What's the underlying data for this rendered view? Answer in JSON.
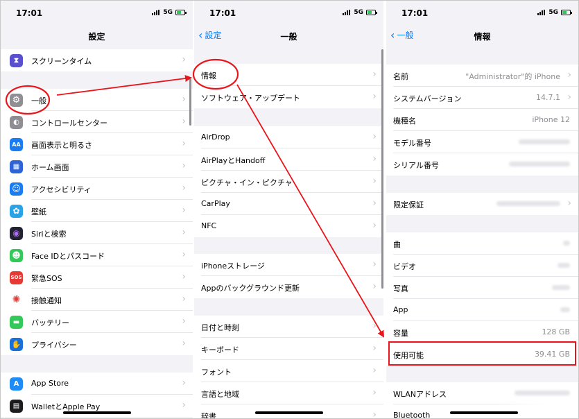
{
  "colors": {
    "accent": "#007aff",
    "annotation": "#e8151b",
    "icons": {
      "screen-time": "#5a4fcf",
      "general": "#8e8e93",
      "control-center": "#8e8e93",
      "display": "#1a7cf0",
      "home-screen": "#2c64d6",
      "accessibility": "#1a7cf0",
      "wallpaper": "#2aa3e6",
      "siri": "#222233",
      "face-id": "#34c759",
      "sos": "#e53935",
      "exposure": "#ffffff",
      "battery": "#34c759",
      "privacy": "#1a6fd8",
      "app-store": "#1d8df5",
      "wallet": "#1c1c1e"
    }
  },
  "status": {
    "time": "17:01",
    "network": "5G"
  },
  "panel1": {
    "title": "設定",
    "items": [
      {
        "label": "スクリーンタイム",
        "icon": "hourglass-icon",
        "glyph": "⧗"
      },
      {
        "label": "一般",
        "icon": "gear-icon",
        "glyph": "⚙"
      },
      {
        "label": "コントロールセンター",
        "icon": "toggles-icon",
        "glyph": "◐"
      },
      {
        "label": "画面表示と明るさ",
        "icon": "display-icon",
        "glyph": "AA"
      },
      {
        "label": "ホーム画面",
        "icon": "grid-icon",
        "glyph": "▦"
      },
      {
        "label": "アクセシビリティ",
        "icon": "accessibility-icon",
        "glyph": "☺"
      },
      {
        "label": "壁紙",
        "icon": "flower-icon",
        "glyph": "✿"
      },
      {
        "label": "Siriと検索",
        "icon": "siri-icon",
        "glyph": "◉"
      },
      {
        "label": "Face IDとパスコード",
        "icon": "face-id-icon",
        "glyph": "☻"
      },
      {
        "label": "緊急SOS",
        "icon": "sos-icon",
        "glyph": "SOS"
      },
      {
        "label": "接触通知",
        "icon": "exposure-icon",
        "glyph": "✺"
      },
      {
        "label": "バッテリー",
        "icon": "battery-icon",
        "glyph": "▬"
      },
      {
        "label": "プライバシー",
        "icon": "hand-icon",
        "glyph": "✋"
      },
      {
        "label": "App Store",
        "icon": "app-store-icon",
        "glyph": "A"
      },
      {
        "label": "WalletとApple Pay",
        "icon": "wallet-icon",
        "glyph": "▤"
      }
    ]
  },
  "panel2": {
    "back": "設定",
    "title": "一般",
    "items": [
      "情報",
      "ソフトウェア・アップデート",
      "AirDrop",
      "AirPlayとHandoff",
      "ピクチャ・イン・ピクチャ",
      "CarPlay",
      "NFC",
      "iPhoneストレージ",
      "Appのバックグラウンド更新",
      "日付と時刻",
      "キーボード",
      "フォント",
      "言語と地域",
      "辞書"
    ]
  },
  "panel3": {
    "back": "一般",
    "title": "情報",
    "rows": [
      {
        "label": "名前",
        "value": "\"Administrator\"的 iPhone",
        "chevron": true
      },
      {
        "label": "システムバージョン",
        "value": "14.7.1",
        "chevron": true
      },
      {
        "label": "機種名",
        "value": "iPhone 12",
        "chevron": false
      },
      {
        "label": "モデル番号",
        "value": "",
        "chevron": false
      },
      {
        "label": "シリアル番号",
        "value": "",
        "chevron": false
      },
      {
        "label": "限定保証",
        "value": "",
        "chevron": true
      },
      {
        "label": "曲",
        "value": "",
        "chevron": false
      },
      {
        "label": "ビデオ",
        "value": "",
        "chevron": false
      },
      {
        "label": "写真",
        "value": "",
        "chevron": false
      },
      {
        "label": "App",
        "value": "",
        "chevron": false
      },
      {
        "label": "容量",
        "value": "128 GB",
        "chevron": false
      },
      {
        "label": "使用可能",
        "value": "39.41 GB",
        "chevron": false
      },
      {
        "label": "WLANアドレス",
        "value": "",
        "chevron": false
      },
      {
        "label": "Bluetooth",
        "value": "",
        "chevron": false
      }
    ]
  }
}
